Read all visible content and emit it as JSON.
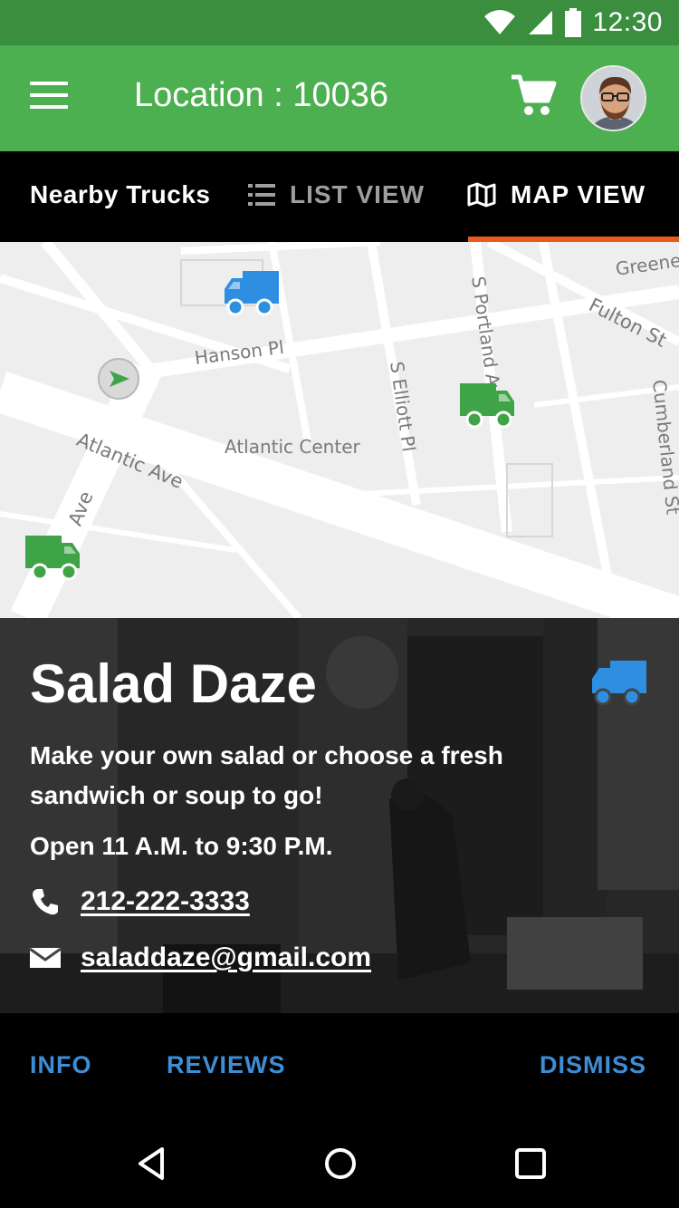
{
  "status_bar": {
    "time": "12:30",
    "icons": [
      "wifi-icon",
      "signal-icon",
      "battery-icon"
    ]
  },
  "app_bar": {
    "title": "Location : 10036",
    "menu_icon": "menu-icon",
    "cart_icon": "cart-icon",
    "avatar": "user-avatar"
  },
  "tabs": {
    "section_label": "Nearby Trucks",
    "list_view": "LIST VIEW",
    "map_view": "MAP VIEW",
    "active": "MAP VIEW",
    "indicator_color": "#e8591c"
  },
  "map": {
    "labels": {
      "hanson": "Hanson Pl",
      "atlantic_ave": "Atlantic Ave",
      "atlantic_center": "Atlantic Center",
      "elliott": "S Elliott Pl",
      "portland": "S Portland Ave",
      "fulton": "Fulton St",
      "greene": "Greene Ave",
      "cumberland": "Cumberland St",
      "ave": "Ave"
    },
    "markers": [
      {
        "name": "truck-marker-blue",
        "color": "#2e8fe0",
        "selected": true
      },
      {
        "name": "truck-marker-green",
        "color": "#3fa447",
        "selected": false
      },
      {
        "name": "truck-marker-green",
        "color": "#3fa447",
        "selected": false
      }
    ]
  },
  "truck": {
    "name": "Salad Daze",
    "description": "Make your own salad or choose a fresh sandwich or soup to go!",
    "hours": "Open 11 A.M. to 9:30 P.M.",
    "phone": "212-222-3333",
    "email": "saladdaze@gmail.com",
    "icon_color": "#2e8fe0"
  },
  "actions": {
    "info": "INFO",
    "reviews": "REVIEWS",
    "dismiss": "DISMISS",
    "color": "#3d8ed6"
  },
  "nav": {
    "back": "back-icon",
    "home": "home-icon",
    "recents": "recents-icon"
  }
}
